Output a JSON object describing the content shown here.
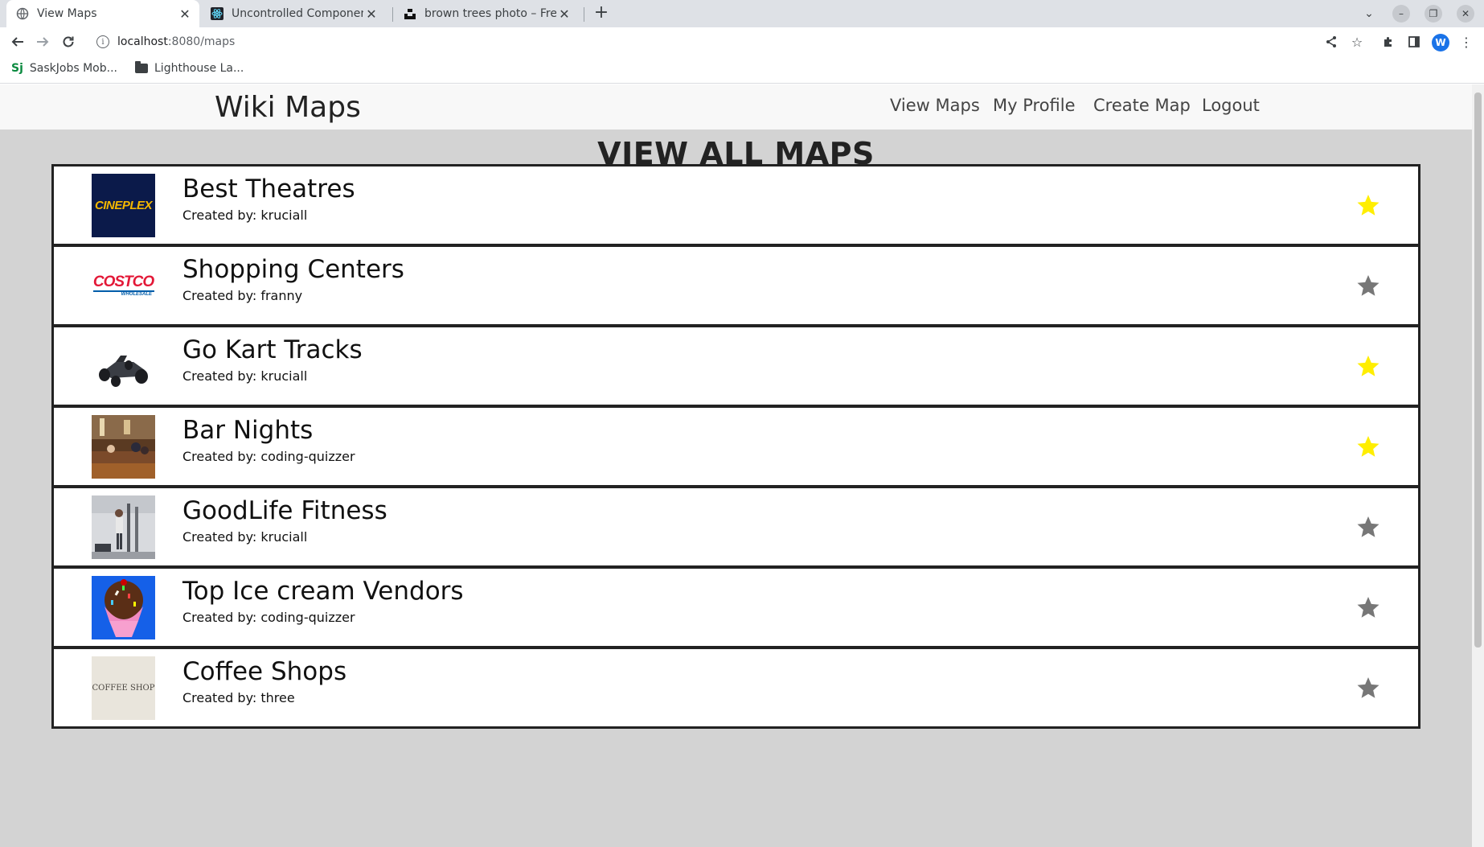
{
  "browser": {
    "tabs": [
      {
        "title": "View Maps",
        "active": true
      },
      {
        "title": "Uncontrolled Component",
        "active": false
      },
      {
        "title": "brown trees photo – Free",
        "active": false
      }
    ],
    "new_tab_label": "+",
    "url_host": "localhost",
    "url_path": ":8080/maps",
    "profile_initial": "W",
    "bookmarks": [
      {
        "label": "SaskJobs Mob...",
        "icon": "sj"
      },
      {
        "label": "Lighthouse La...",
        "icon": "folder"
      }
    ]
  },
  "site": {
    "brand": "Wiki Maps",
    "nav": [
      "View Maps",
      "My Profile",
      "Create Map",
      "Logout"
    ],
    "page_title": "VIEW ALL MAPS"
  },
  "colors": {
    "star_favorited": "#ffee00",
    "star_default": "#777777",
    "page_bg": "#d3d3d3"
  },
  "maps": [
    {
      "name": "Best Theatres",
      "creator": "Created by: kruciall",
      "favorited": true,
      "thumb": "cineplex-logo",
      "thumb_text": "CINEPLEX"
    },
    {
      "name": "Shopping Centers",
      "creator": "Created by: franny",
      "favorited": false,
      "thumb": "costco-logo",
      "thumb_text": "COSTCO",
      "thumb_subtext": "WHOLESALE"
    },
    {
      "name": "Go Kart Tracks",
      "creator": "Created by: kruciall",
      "favorited": true,
      "thumb": "go-kart-photo"
    },
    {
      "name": "Bar Nights",
      "creator": "Created by: coding-quizzer",
      "favorited": true,
      "thumb": "bar-photo"
    },
    {
      "name": "GoodLife Fitness",
      "creator": "Created by: kruciall",
      "favorited": false,
      "thumb": "fitness-photo"
    },
    {
      "name": "Top Ice cream Vendors",
      "creator": "Created by: coding-quizzer",
      "favorited": false,
      "thumb": "ice-cream-photo"
    },
    {
      "name": "Coffee Shops",
      "creator": "Created by: three",
      "favorited": false,
      "thumb": "coffee-shop-logo",
      "thumb_text": "COFFEE SHOP"
    }
  ]
}
